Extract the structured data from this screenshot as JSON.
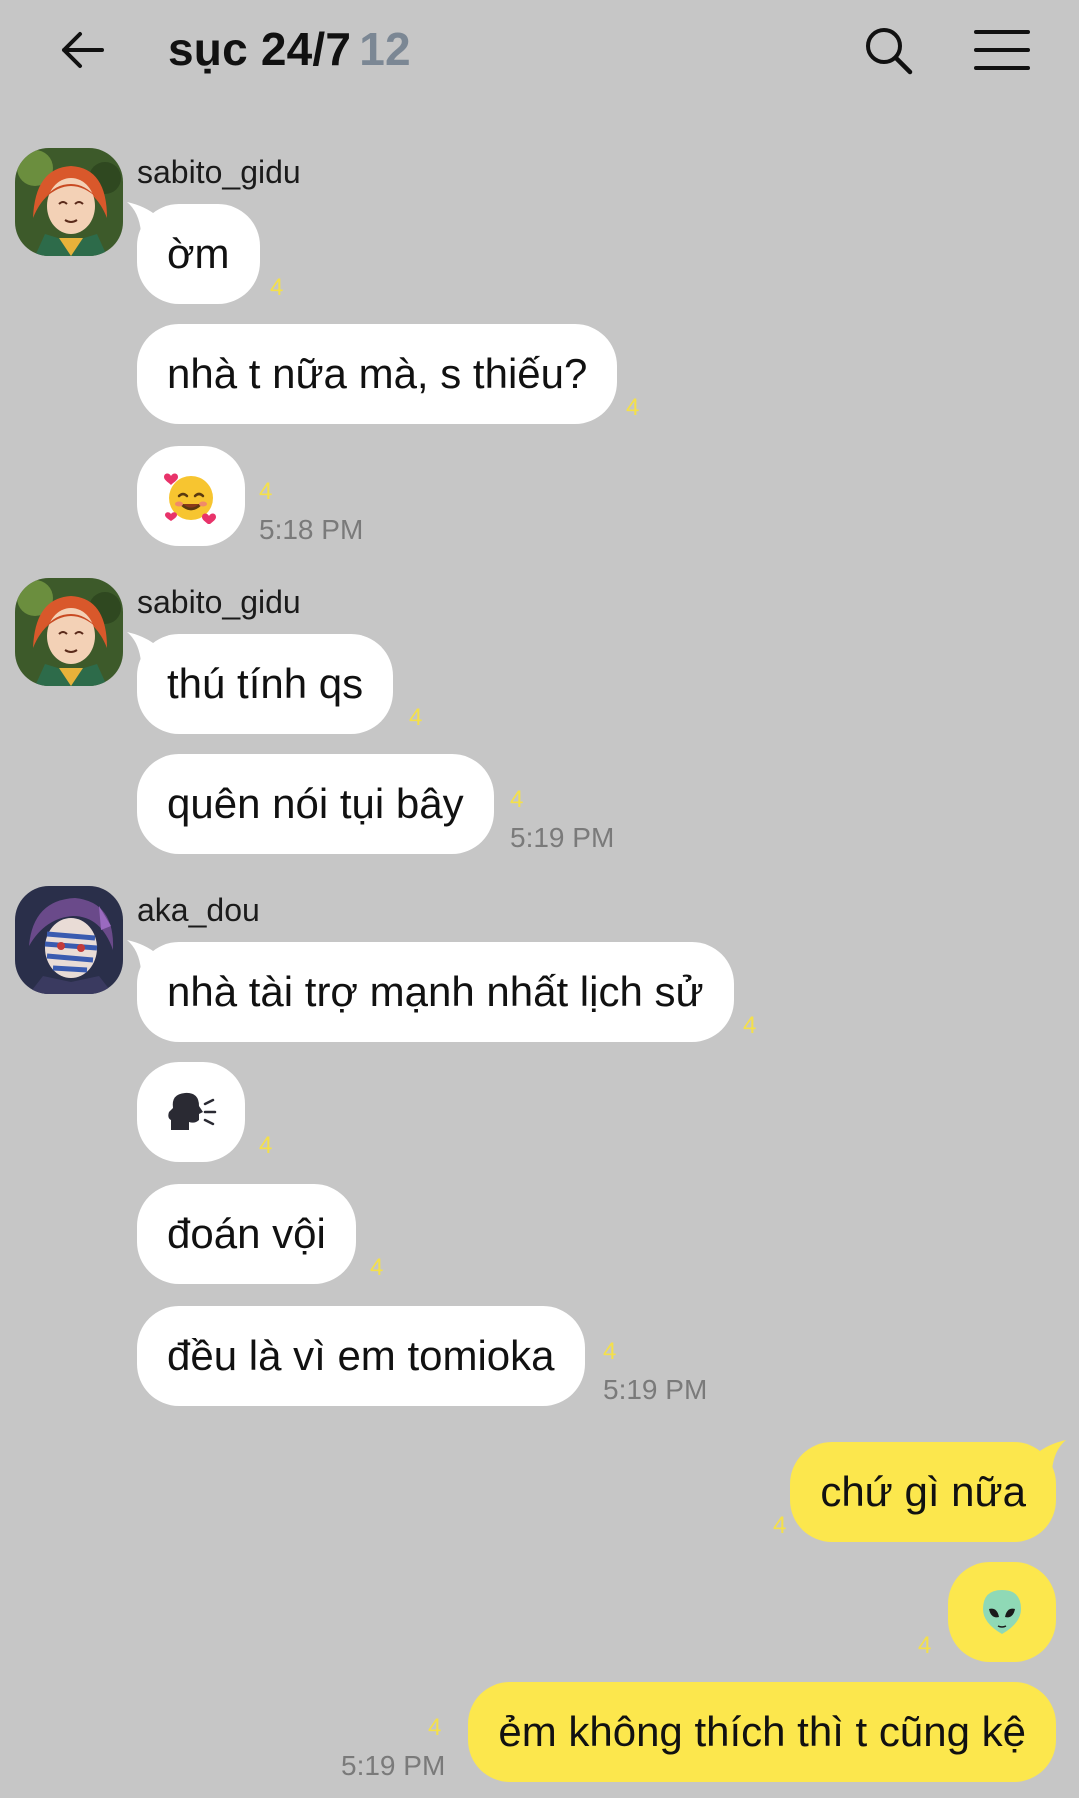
{
  "header": {
    "title": "sục 24/7",
    "member_count": "12"
  },
  "messages": {
    "g1": {
      "sender": "sabito_gidu",
      "m1": "ờm",
      "m2": "nhà t nữa mà, s thiếu?",
      "m3_emoji": "smiling-face-with-hearts",
      "u1": "4",
      "u2": "4",
      "u3": "4",
      "time": "5:18 PM"
    },
    "g2": {
      "sender": "sabito_gidu",
      "m1": "thú tính qs",
      "m2": "quên nói tụi bây",
      "u1": "4",
      "u2": "4",
      "time": "5:19 PM"
    },
    "g3": {
      "sender": "aka_dou",
      "m1": "nhà tài trợ mạnh nhất lịch sử",
      "m2_emoji": "speaking-head",
      "m3": "đoán vội",
      "m4": "đều là vì em tomioka",
      "u1": "4",
      "u2": "4",
      "u3": "4",
      "u4": "4",
      "time": "5:19 PM"
    },
    "mine": {
      "m1": "chứ gì nữa",
      "m2_emoji": "alien",
      "m3": "ẻm không thích thì t cũng kệ",
      "u1": "4",
      "u2": "4",
      "u3": "4",
      "time": "5:19 PM"
    }
  },
  "colors": {
    "background": "#c6c6c6",
    "my_bubble": "#fce74d",
    "other_bubble": "#ffffff",
    "unread": "#f4e04a",
    "member_count": "#7b8794"
  }
}
